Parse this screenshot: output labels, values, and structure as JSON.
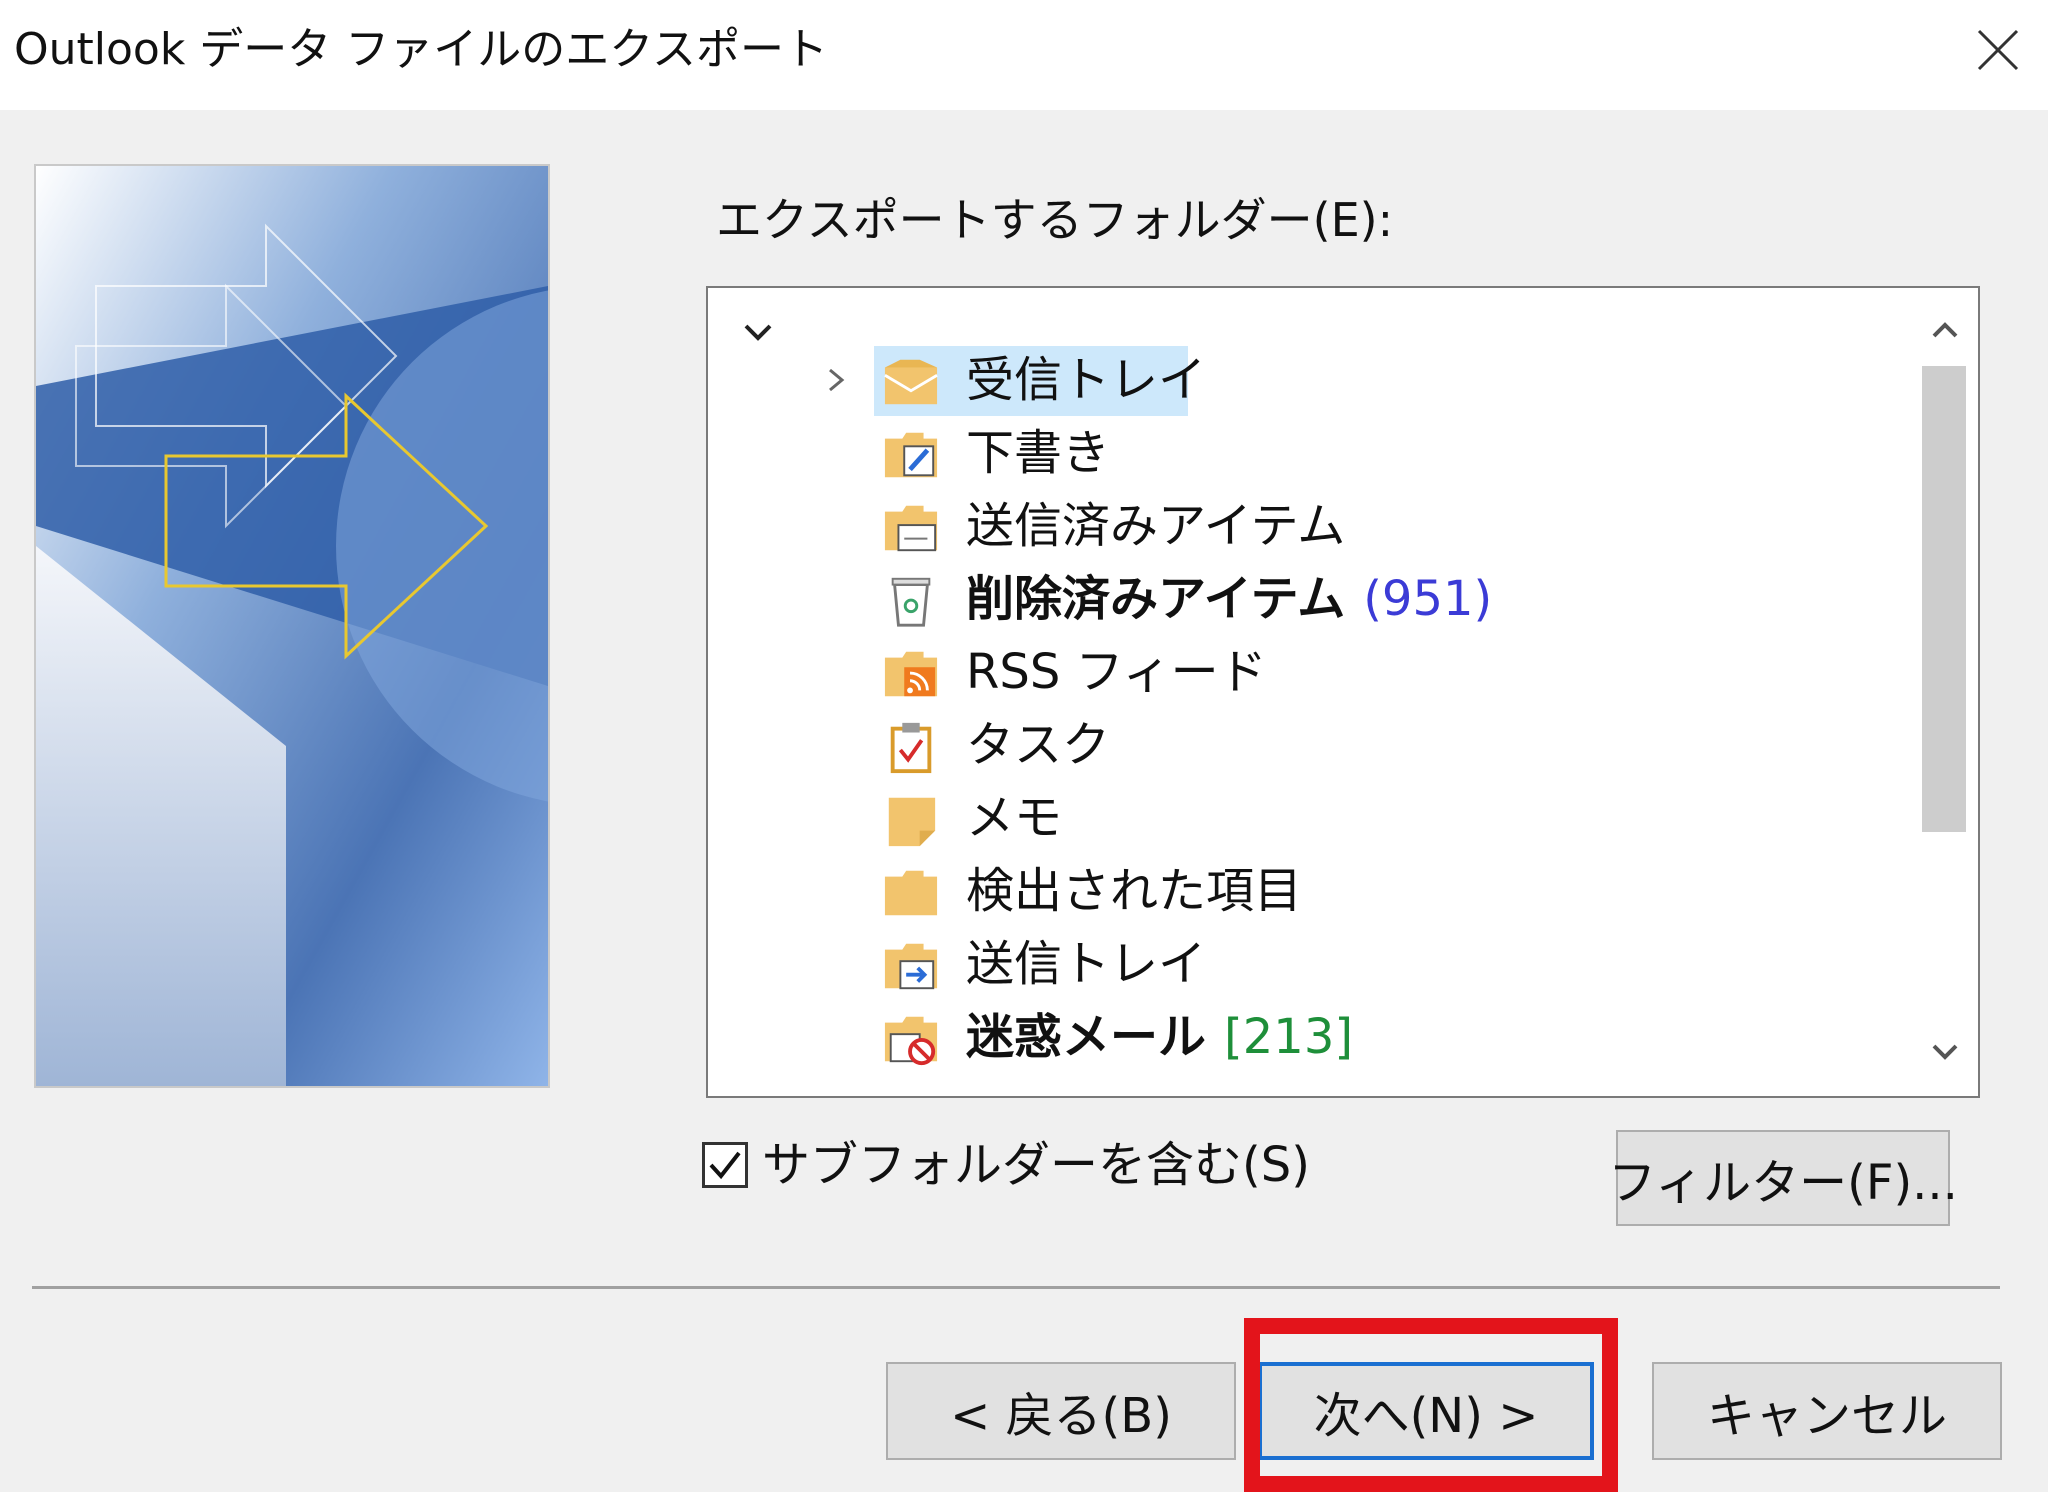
{
  "window": {
    "title": "Outlook データ ファイルのエクスポート",
    "close_icon": "close-icon"
  },
  "folders_label": "エクスポートするフォルダー(E):",
  "tree": {
    "items": [
      {
        "label": "受信トレイ",
        "icon": "inbox-folder-icon",
        "selected": true,
        "expandable": true,
        "bold": false,
        "count": ""
      },
      {
        "label": "下書き",
        "icon": "drafts-folder-icon",
        "selected": false,
        "expandable": false,
        "bold": false,
        "count": ""
      },
      {
        "label": "送信済みアイテム",
        "icon": "sent-items-folder-icon",
        "selected": false,
        "expandable": false,
        "bold": false,
        "count": ""
      },
      {
        "label": "削除済みアイテム",
        "icon": "trash-can-icon",
        "selected": false,
        "expandable": false,
        "bold": true,
        "count": "(951)"
      },
      {
        "label": "RSS フィード",
        "icon": "rss-folder-icon",
        "selected": false,
        "expandable": false,
        "bold": false,
        "count": ""
      },
      {
        "label": "タスク",
        "icon": "task-clipboard-icon",
        "selected": false,
        "expandable": false,
        "bold": false,
        "count": ""
      },
      {
        "label": "メモ",
        "icon": "sticky-note-icon",
        "selected": false,
        "expandable": false,
        "bold": false,
        "count": ""
      },
      {
        "label": "検出された項目",
        "icon": "folder-icon",
        "selected": false,
        "expandable": false,
        "bold": false,
        "count": ""
      },
      {
        "label": "送信トレイ",
        "icon": "outbox-folder-icon",
        "selected": false,
        "expandable": false,
        "bold": false,
        "count": ""
      },
      {
        "label": "迷惑メール",
        "icon": "junk-folder-icon",
        "selected": false,
        "expandable": false,
        "bold": true,
        "count": "[213]"
      }
    ]
  },
  "include_subfolders": {
    "label": "サブフォルダーを含む(S)",
    "checked": true
  },
  "buttons": {
    "filter": "フィルター(F)...",
    "back": "< 戻る(B)",
    "next": "次へ(N) >",
    "cancel": "キャンセル"
  },
  "colors": {
    "highlight": "#e3141b",
    "selection": "#cde8fb",
    "count_blue": "#3b3bd6",
    "count_green": "#1e8f3a",
    "default_button_border": "#1a6fd1"
  }
}
